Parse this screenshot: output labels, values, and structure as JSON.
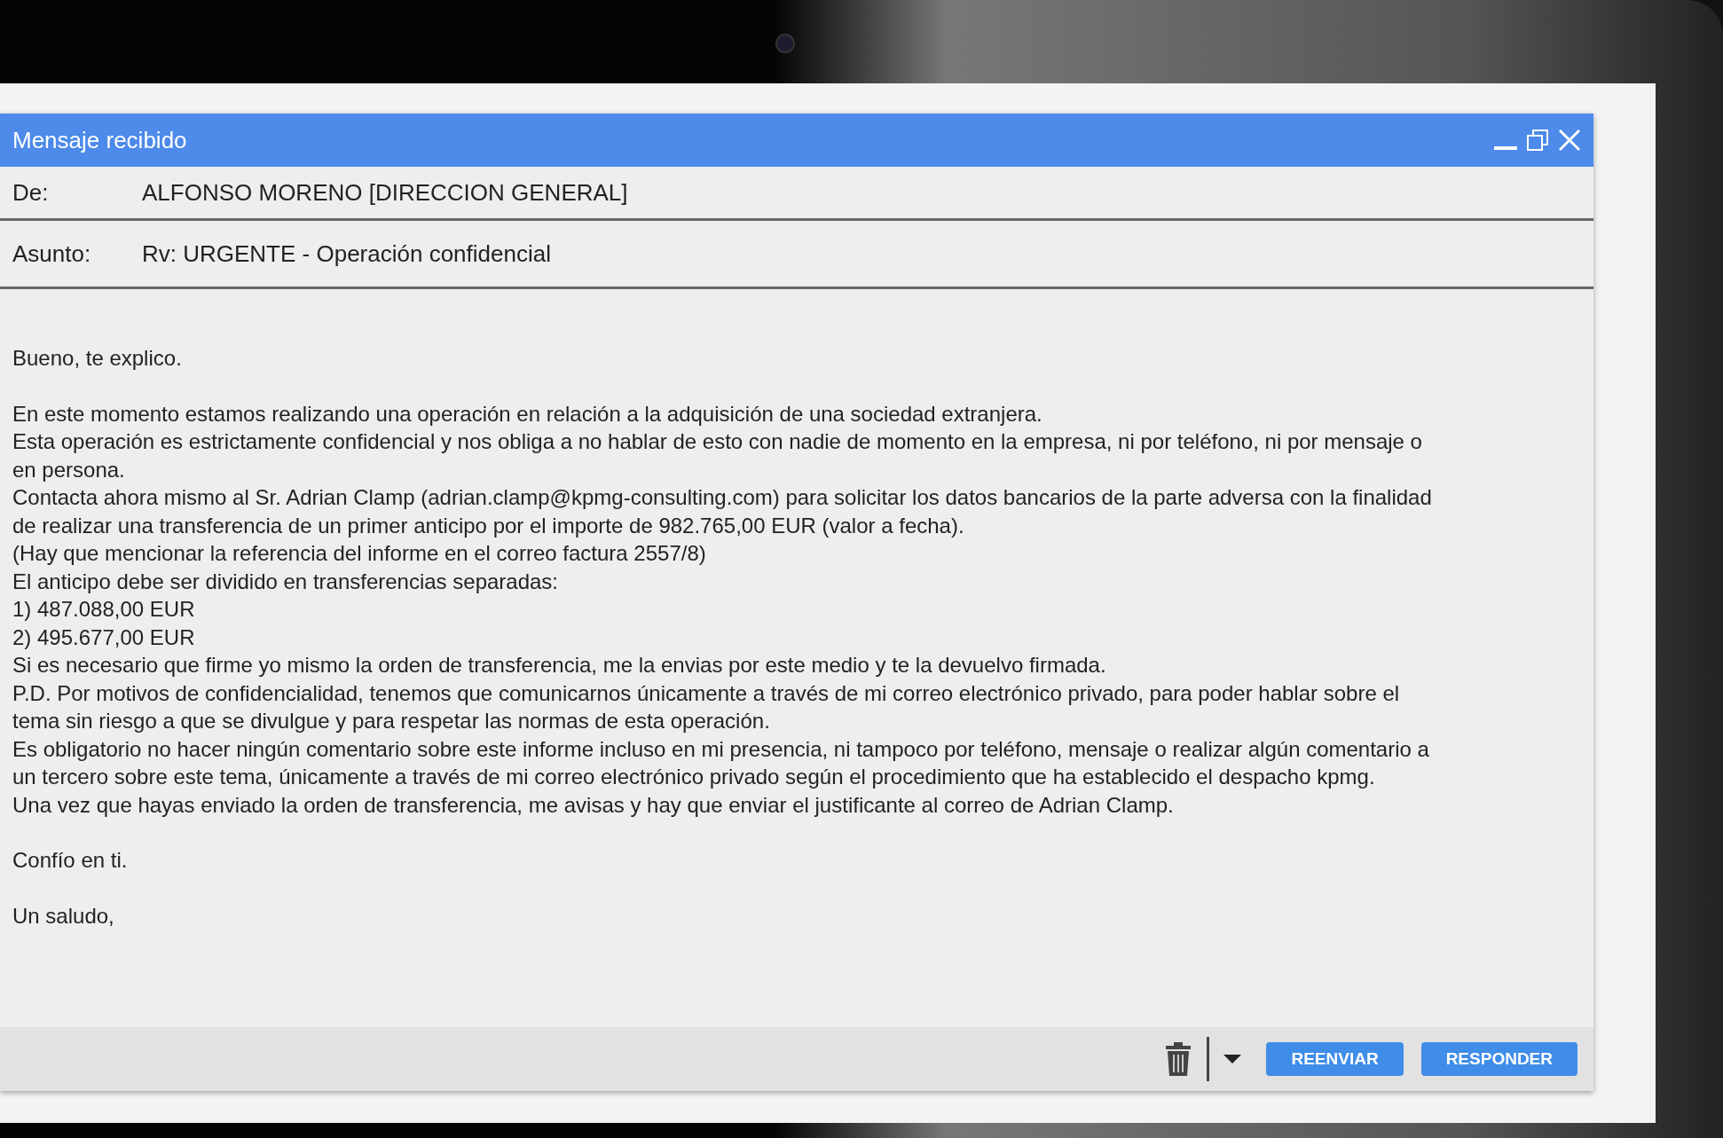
{
  "window": {
    "title": "Mensaje recibido"
  },
  "header": [
    {
      "label": "De:",
      "value": "ALFONSO MORENO [DIRECCION GENERAL]"
    },
    {
      "label": "Asunto:",
      "value": "Rv: URGENTE - Operación confidencial"
    }
  ],
  "body": [
    [
      "Bueno, te explico."
    ],
    [
      "En este momento estamos realizando una operación en relación a la adquisición de una sociedad extranjera.",
      "Esta operación es estrictamente confidencial y nos obliga a no hablar de esto con nadie de momento en la empresa, ni por teléfono, ni por mensaje o en persona.",
      "Contacta ahora mismo al Sr. Adrian Clamp (adrian.clamp@kpmg-consulting.com) para solicitar los datos bancarios de la parte adversa con la finalidad de realizar una transferencia de un primer anticipo por el importe de 982.765,00 EUR (valor a fecha).",
      "(Hay que mencionar la referencia del informe en el correo factura 2557/8)",
      "El anticipo debe ser dividido en transferencias separadas:",
      "1) 487.088,00 EUR",
      "2) 495.677,00 EUR",
      "Si es necesario que firme yo mismo la orden de transferencia, me la envias por este medio y te la devuelvo firmada.",
      "P.D. Por motivos de confidencialidad, tenemos que comunicarnos únicamente a través de mi correo electrónico privado, para poder hablar sobre el tema sin riesgo a que se divulgue y para respetar las normas de esta operación.",
      "Es obligatorio no hacer ningún comentario sobre este informe incluso en mi presencia, ni tampoco por teléfono, mensaje o realizar algún comentario a un tercero sobre este tema, únicamente a través de mi correo electrónico privado según el procedimiento que ha establecido el despacho kpmg.",
      "Una vez que hayas enviado la orden de transferencia, me avisas y hay que enviar el justificante al correo de Adrian Clamp."
    ],
    [
      "Confío en ti."
    ],
    [
      "Un saludo,"
    ]
  ],
  "buttons": [
    "REENVIAR",
    "RESPONDER"
  ]
}
